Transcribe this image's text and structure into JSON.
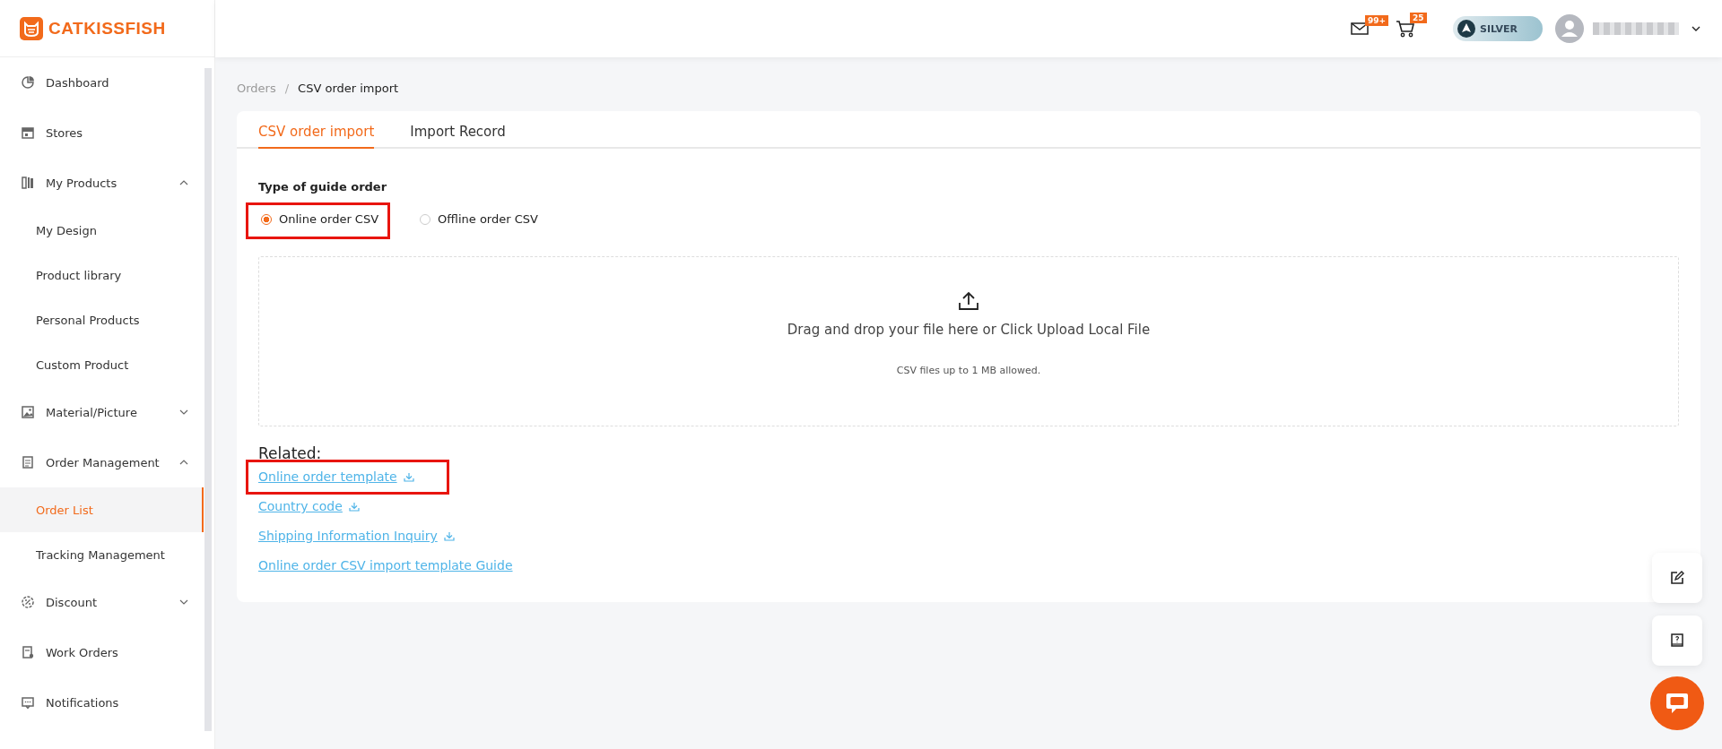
{
  "logo": {
    "text": "CATKISSFISH"
  },
  "header": {
    "mail_badge": "99+",
    "cart_badge": "25",
    "tier": "SILVER"
  },
  "sidebar": {
    "items": [
      {
        "label": "Dashboard",
        "selected": false
      },
      {
        "label": "Stores",
        "selected": false
      },
      {
        "label": "My Products",
        "selected": false,
        "expanded": true,
        "children": [
          {
            "label": "My Design",
            "selected": false
          },
          {
            "label": "Product library",
            "selected": false
          },
          {
            "label": "Personal Products",
            "selected": false
          },
          {
            "label": "Custom Product",
            "selected": false
          }
        ]
      },
      {
        "label": "Material/Picture",
        "selected": false,
        "expanded": false
      },
      {
        "label": "Order Management",
        "selected": false,
        "expanded": true,
        "children": [
          {
            "label": "Order List",
            "selected": true
          },
          {
            "label": "Tracking Management",
            "selected": false
          }
        ]
      },
      {
        "label": "Discount",
        "selected": false,
        "expanded": false
      },
      {
        "label": "Work Orders",
        "selected": false
      },
      {
        "label": "Notifications",
        "selected": false
      }
    ]
  },
  "breadcrumb": {
    "items": [
      "Orders",
      "CSV order import"
    ],
    "separator": "/"
  },
  "tabs": [
    {
      "label": "CSV order import",
      "selected": true
    },
    {
      "label": "Import Record",
      "selected": false
    }
  ],
  "form": {
    "label": "Type of guide order",
    "options": [
      {
        "label": "Online order CSV",
        "selected": true,
        "highlighted": true
      },
      {
        "label": "Offline order CSV",
        "selected": false,
        "highlighted": false
      }
    ],
    "upload": {
      "text": "Drag and drop your file here or Click Upload Local File",
      "hint": "CSV files up to 1 MB allowed."
    },
    "related_label": "Related:",
    "links": [
      {
        "label": "Online order template",
        "download": true,
        "highlighted": true
      },
      {
        "label": "Country code",
        "download": true,
        "highlighted": false
      },
      {
        "label": "Shipping Information Inquiry",
        "download": true,
        "highlighted": false
      },
      {
        "label": "Online order CSV import template Guide",
        "download": false,
        "highlighted": false
      }
    ]
  }
}
